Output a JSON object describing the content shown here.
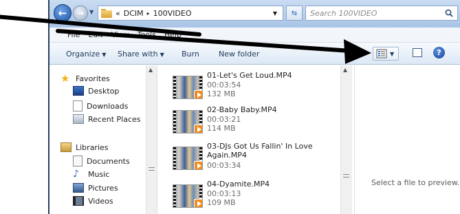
{
  "address": {
    "overflow": "«",
    "crumbs": [
      "DCIM",
      "100VIDEO"
    ],
    "separator": "▸"
  },
  "search": {
    "placeholder": "Search 100VIDEO"
  },
  "menu": [
    "File",
    "Edit",
    "View",
    "Tools",
    "Help"
  ],
  "toolbar": {
    "organize": "Organize",
    "share_with": "Share with",
    "burn": "Burn",
    "new_folder": "New folder"
  },
  "nav": {
    "favorites": "Favorites",
    "desktop": "Desktop",
    "downloads": "Downloads",
    "recent_places": "Recent Places",
    "libraries": "Libraries",
    "documents": "Documents",
    "music": "Music",
    "pictures": "Pictures",
    "videos": "Videos"
  },
  "files": [
    {
      "name": "01-Let's Get Loud.MP4",
      "duration": "00:03:54",
      "size": "132 MB"
    },
    {
      "name": "02-Baby Baby.MP4",
      "duration": "00:03:21",
      "size": "114 MB"
    },
    {
      "name": "03-DJs Got Us Fallin' In Love Again.MP4",
      "duration": "00:03:34",
      "size": ""
    },
    {
      "name": "04-Dyamite.MP4",
      "duration": "00:03:13",
      "size": "109 MB"
    }
  ],
  "preview": {
    "message": "Select a file to preview."
  },
  "colors": {
    "annotation_arrow": "#000000",
    "titlebar": "#b7cde9",
    "video_badge": "#f08a1c"
  },
  "icons": {
    "back": "back-arrow-icon",
    "forward": "forward-arrow-icon",
    "refresh": "refresh-icon",
    "search": "magnifier-icon",
    "views": "details-view-icon",
    "preview_pane": "preview-pane-icon",
    "help": "help-icon"
  }
}
